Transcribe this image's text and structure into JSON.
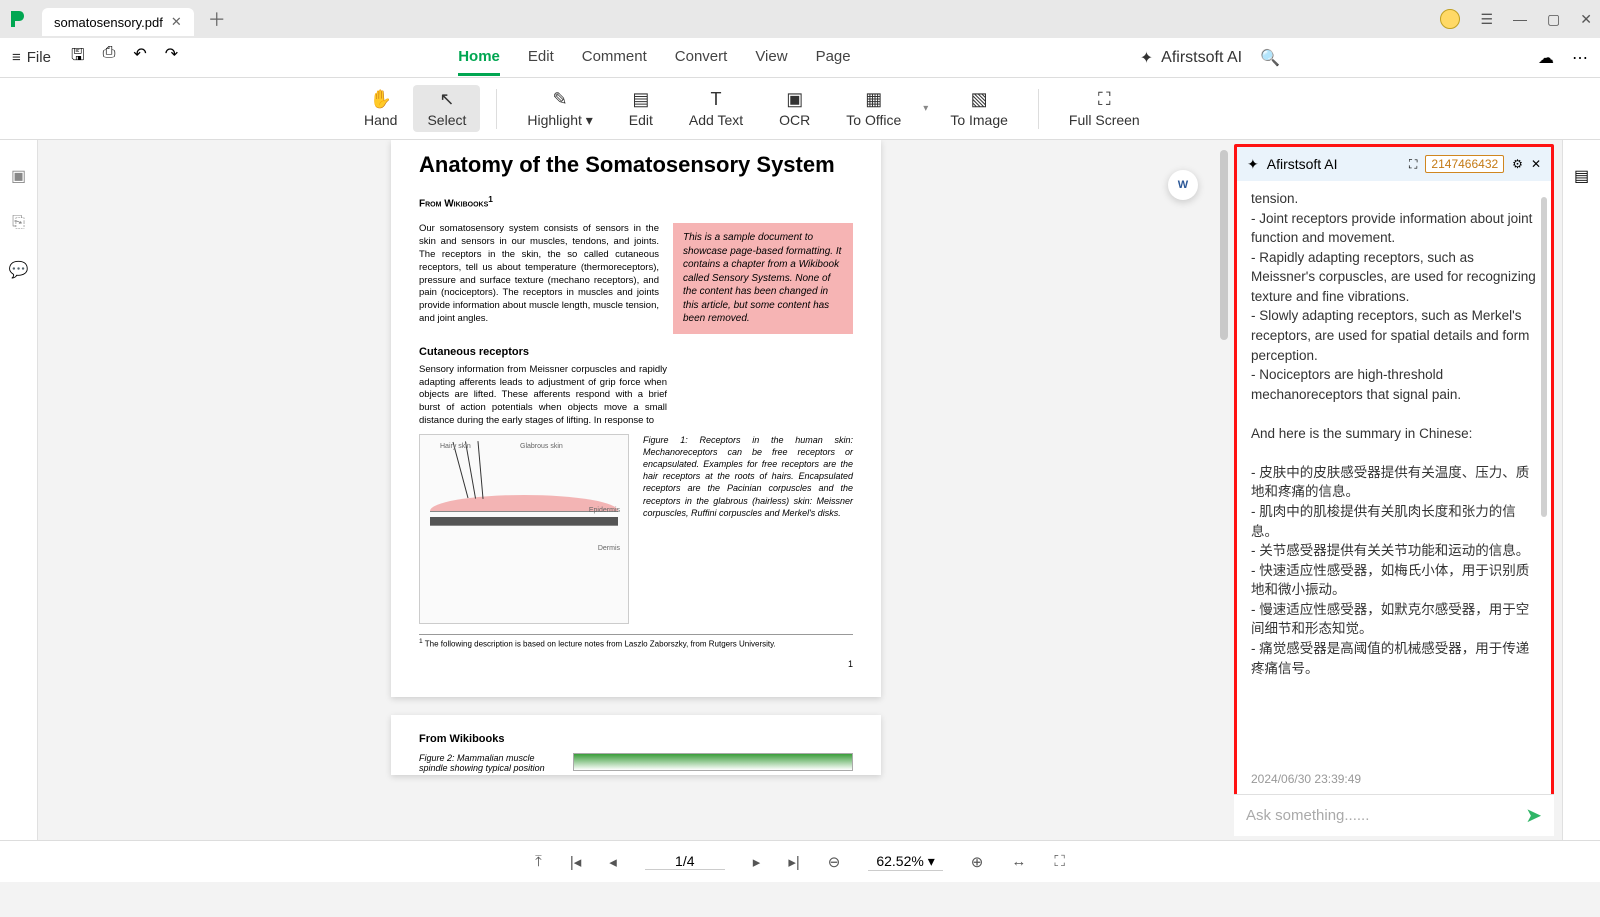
{
  "titlebar": {
    "tab_name": "somatosensory.pdf"
  },
  "menubar": {
    "file": "File",
    "tabs": [
      "Home",
      "Edit",
      "Comment",
      "Convert",
      "View",
      "Page"
    ],
    "active_tab": "Home",
    "ai_brand": "Afirstsoft AI"
  },
  "toolbar": {
    "hand": "Hand",
    "select": "Select",
    "highlight": "Highlight",
    "edit": "Edit",
    "add_text": "Add Text",
    "ocr": "OCR",
    "to_office": "To Office",
    "to_image": "To Image",
    "full_screen": "Full Screen"
  },
  "doc": {
    "title": "Anatomy of the Somatosensory System",
    "from": "From Wikibooks",
    "sup": "1",
    "body1": "Our somatosensory system consists of sensors in the skin and sensors in our muscles, tendons, and joints. The receptors in the skin, the so called cutaneous receptors, tell us about temperature (thermoreceptors), pressure and surface texture (mechano receptors), and pain (nociceptors). The receptors in muscles and joints provide information about muscle length, muscle tension, and joint angles.",
    "callout": "This is a sample document to showcase page-based formatting. It contains a chapter from a Wikibook called Sensory Systems. None of the content has been changed in this article, but some content has been removed.",
    "subhead": "Cutaneous receptors",
    "body2": "Sensory information from Meissner corpuscles and rapidly adapting afferents leads to adjustment of grip force when objects are lifted. These afferents respond with a brief burst of action potentials when objects move a small distance during the early stages of lifting. In response to",
    "fig1_cap": "Figure 1: Receptors in the human skin: Mechanoreceptors can be free receptors or encapsulated. Examples for free receptors are the hair receptors at the roots of hairs. Encapsulated receptors are the Pacinian corpuscles and the receptors in the glabrous (hairless) skin: Meissner corpuscles, Ruffini corpuscles and Merkel's disks.",
    "footnote": "The following description is based on lecture notes from Laszlo Zaborszky, from Rutgers University.",
    "page_num": "1",
    "p2_from": "From Wikibooks",
    "p2_fig": "Figure 2: Mammalian muscle spindle showing typical position"
  },
  "ai": {
    "title": "Afirstsoft AI",
    "id": "2147466432",
    "line0": "tension.",
    "line1": "- Joint receptors provide information about joint function and movement.",
    "line2": "- Rapidly adapting receptors, such as Meissner's corpuscles, are used for recognizing texture and fine vibrations.",
    "line3": "- Slowly adapting receptors, such as Merkel's receptors, are used for spatial details and form perception.",
    "line4": "- Nociceptors are high-threshold mechanoreceptors that signal pain.",
    "summary_intro": "And here is the summary in Chinese:",
    "zh1": "- 皮肤中的皮肤感受器提供有关温度、压力、质地和疼痛的信息。",
    "zh2": "- 肌肉中的肌梭提供有关肌肉长度和张力的信息。",
    "zh3": "- 关节感受器提供有关关节功能和运动的信息。",
    "zh4": "- 快速适应性感受器，如梅氏小体，用于识别质地和微小振动。",
    "zh5": "- 慢速适应性感受器，如默克尔感受器，用于空间细节和形态知觉。",
    "zh6": "- 痛觉感受器是高阈值的机械感受器，用于传递疼痛信号。",
    "timestamp": "2024/06/30 23:39:49",
    "placeholder": "Ask something......"
  },
  "status": {
    "page_counter": "1/4",
    "zoom": "62.52%"
  }
}
